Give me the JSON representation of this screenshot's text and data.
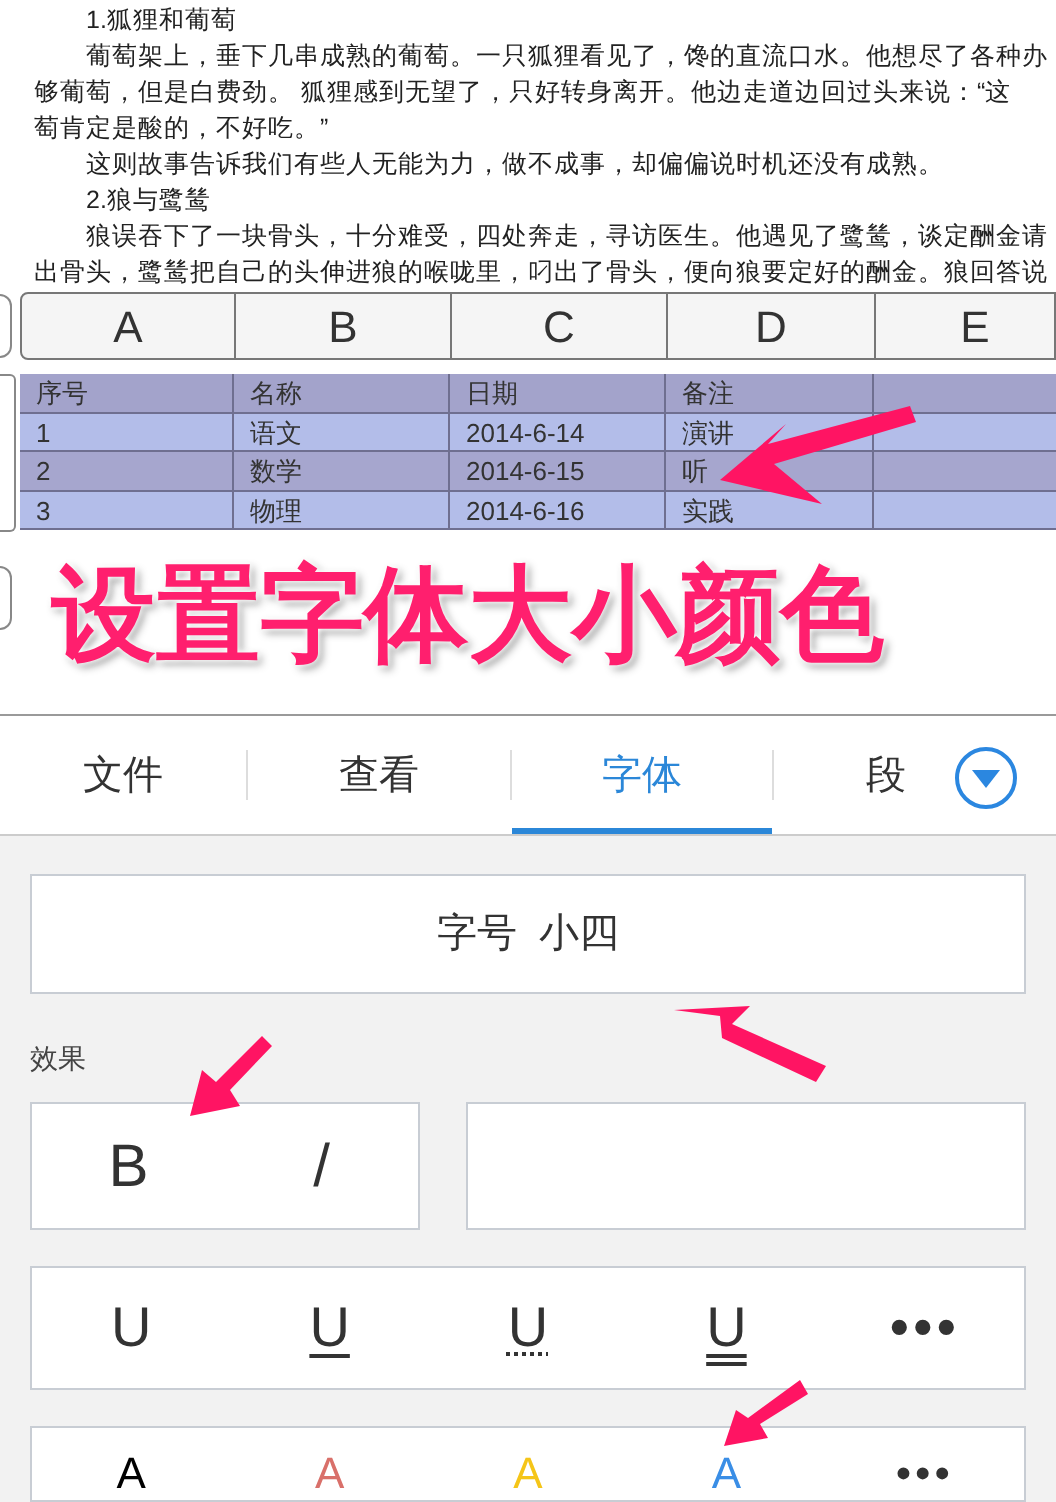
{
  "document": {
    "lines": [
      {
        "text": "1.狐狸和葡萄",
        "indented": true
      },
      {
        "text": "葡萄架上，垂下几串成熟的葡萄。一只狐狸看见了，馋的直流口水。他想尽了各种办",
        "indented": true
      },
      {
        "text": "够葡萄，但是白费劲。    狐狸感到无望了，只好转身离开。他边走道边回过头来说：“这",
        "indented": false
      },
      {
        "text": "萄肯定是酸的，不好吃。”",
        "indented": false
      },
      {
        "text": "这则故事告诉我们有些人无能为力，做不成事，却偏偏说时机还没有成熟。",
        "indented": true
      },
      {
        "text": "2.狼与鹭鸶",
        "indented": true
      },
      {
        "text": "狼误吞下了一块骨头，十分难受，四处奔走，寻访医生。他遇见了鹭鸶，谈定酬金请",
        "indented": true
      },
      {
        "text": "出骨头，鹭鸶把自己的头伸进狼的喉咙里，叼出了骨头，便向狼要定好的酬金。狼回答说",
        "indented": false
      }
    ]
  },
  "spreadsheet": {
    "column_headers": [
      "A",
      "B",
      "C",
      "D",
      "E"
    ],
    "rows": [
      {
        "kind": "header",
        "cells": [
          "序号",
          "名称",
          "日期",
          "备注"
        ]
      },
      {
        "kind": "data",
        "cells": [
          "1",
          "语文",
          "2014-6-14",
          "演讲"
        ]
      },
      {
        "kind": "data",
        "cells": [
          "2",
          "数学",
          "2014-6-15",
          "听"
        ]
      },
      {
        "kind": "data",
        "cells": [
          "3",
          "物理",
          "2014-6-16",
          "实践"
        ]
      }
    ]
  },
  "caption": "设置字体大小颜色",
  "tabs": [
    {
      "label": "文件",
      "selected": false
    },
    {
      "label": "查看",
      "selected": false
    },
    {
      "label": "字体",
      "selected": true
    },
    {
      "label": "段",
      "selected": false
    }
  ],
  "font_size": {
    "label": "字号",
    "value": "小四"
  },
  "effects_label": "效果",
  "style_buttons": [
    {
      "label": "B"
    },
    {
      "label": "/"
    }
  ],
  "underline_buttons": [
    {
      "label": "U",
      "kind": "none"
    },
    {
      "label": "U",
      "kind": "single"
    },
    {
      "label": "U",
      "kind": "dotted"
    },
    {
      "label": "U",
      "kind": "double"
    },
    {
      "label": "•••",
      "kind": "more"
    }
  ],
  "color_buttons": [
    {
      "label": "A",
      "kind": "color",
      "color": "#000000"
    },
    {
      "label": "A",
      "kind": "color",
      "color": "#d9706a"
    },
    {
      "label": "A",
      "kind": "color",
      "color": "#f5c518"
    },
    {
      "label": "A",
      "kind": "color",
      "color": "#3a8ee6"
    },
    {
      "label": "•••",
      "kind": "more"
    }
  ]
}
